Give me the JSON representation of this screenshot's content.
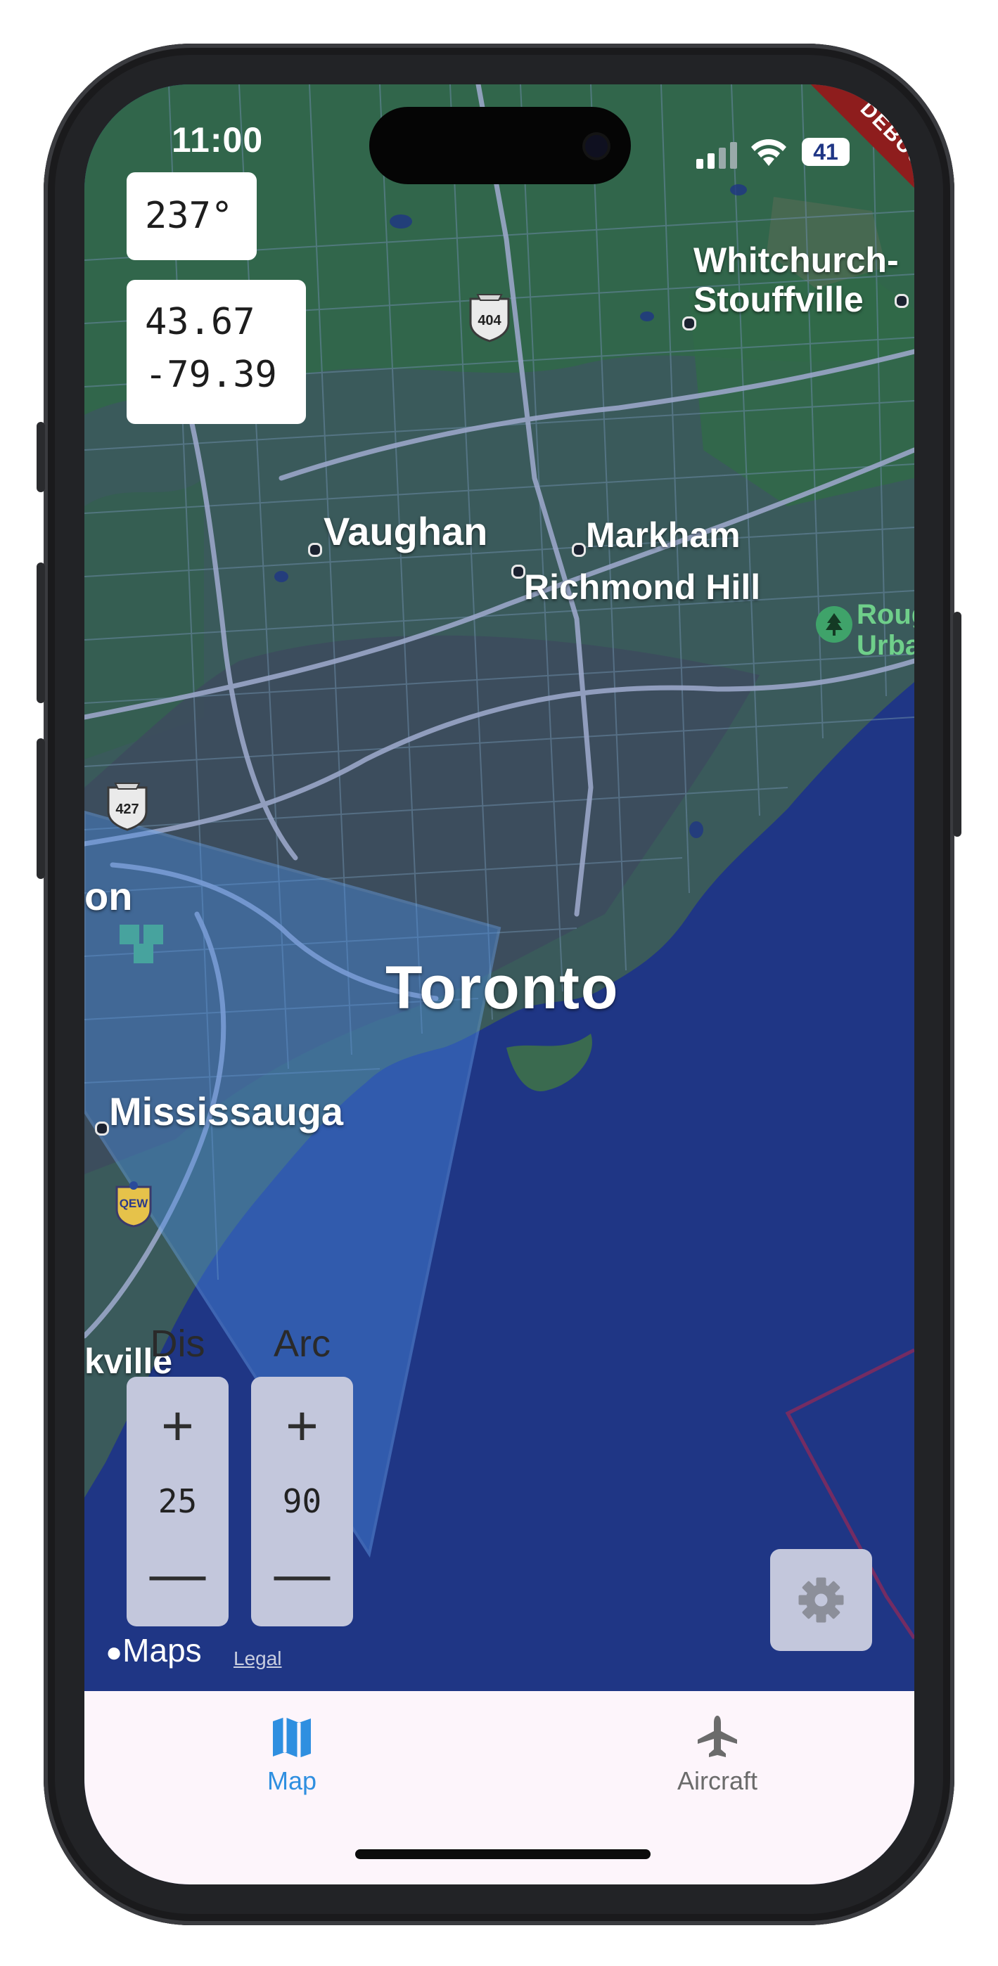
{
  "status_bar": {
    "time": "11:00",
    "battery": "41",
    "debug_banner": "DEBUG"
  },
  "overlays": {
    "heading": "237°",
    "latitude": "43.67",
    "longitude": "-79.39"
  },
  "map": {
    "cities": {
      "whitchurch_line1": "Whitchurch-",
      "whitchurch_line2": "Stouffville",
      "vaughan": "Vaughan",
      "markham": "Markham",
      "richmond_hill": "Richmond Hill",
      "rouge_line1": "Roug",
      "rouge_line2": "Urba",
      "brampton_partial": "on",
      "toronto": "Toronto",
      "mississauga": "Mississauga",
      "oakville_partial": "kville"
    },
    "highway_shields": {
      "h404": "404",
      "h427": "427",
      "qew": "QEW"
    },
    "attribution": {
      "logo": "Maps",
      "legal": "Legal"
    },
    "colors": {
      "water": "#1f3685",
      "land": "#3a5a5b",
      "park": "#2f6b45",
      "road": "#9aa6c8",
      "sector": "#4a8ee6"
    }
  },
  "controls": {
    "distance": {
      "label": "Dis",
      "plus": "+",
      "value": "25",
      "minus": "—"
    },
    "arc": {
      "label": "Arc",
      "plus": "+",
      "value": "90",
      "minus": "—"
    },
    "settings_icon": "gear-icon"
  },
  "tab_bar": {
    "tabs": [
      {
        "label": "Map",
        "icon": "map-icon",
        "active": true,
        "color": "#2f8fe0"
      },
      {
        "label": "Aircraft",
        "icon": "airplane-icon",
        "active": false,
        "color": "#6b6b6b"
      }
    ]
  }
}
